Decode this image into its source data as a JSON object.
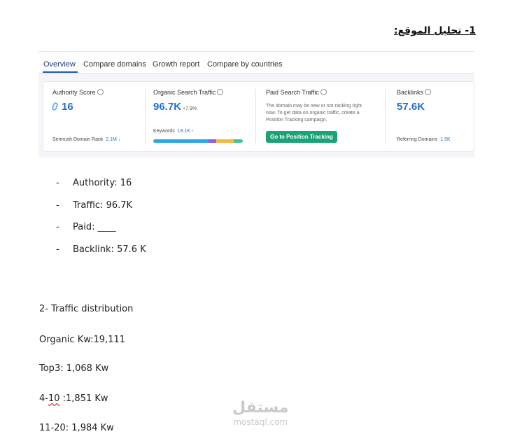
{
  "doc": {
    "heading": "1- تحليل الموقع:"
  },
  "semrush": {
    "tabs": [
      "Overview",
      "Compare domains",
      "Growth report",
      "Compare by countries"
    ],
    "authority": {
      "label": "Authority Score",
      "value": "16",
      "rank_label": "Semrush Domain Rank",
      "rank_value": "2.1M"
    },
    "organic": {
      "label": "Organic Search Traffic",
      "value": "96.7K",
      "delta": "+7.9%",
      "keywords_label": "Keywords",
      "keywords_value": "19.1K"
    },
    "paid": {
      "label": "Paid Search Traffic",
      "description": "The domain may be new or not ranking right now. To get data on organic traffic, create a Position Tracking campaign.",
      "button": "Go to Position Tracking"
    },
    "backlinks": {
      "label": "Backlinks",
      "value": "57.6K",
      "ref_label": "Referring Domains",
      "ref_value": "1.5K"
    },
    "colors": {
      "accent": "#1f6fd1",
      "button": "#1aa378",
      "bar_blue": "#2aa8e8",
      "bar_purple": "#9b59e0",
      "bar_yellow": "#f6b93b",
      "bar_green": "#45c49a"
    }
  },
  "bullets": [
    {
      "dash": "-",
      "text": "Authority: 16"
    },
    {
      "dash": "-",
      "text": "Traffic: 96.7K"
    },
    {
      "dash": "-",
      "text": "Paid: ____"
    },
    {
      "dash": "-",
      "text": "Backlink: 57.6 K"
    }
  ],
  "traffic": {
    "title": "2- Traffic distribution",
    "organic": "Organic Kw:19,111",
    "top3": "Top3: 1,068 Kw",
    "r4_10_prefix": "4-",
    "r4_10_flag": "10",
    "r4_10_suffix": " :1,851 Kw",
    "r11_20": "11-20: 1,984 Kw"
  },
  "watermark": {
    "logo": "مستقل",
    "url": "mostaql.com"
  }
}
